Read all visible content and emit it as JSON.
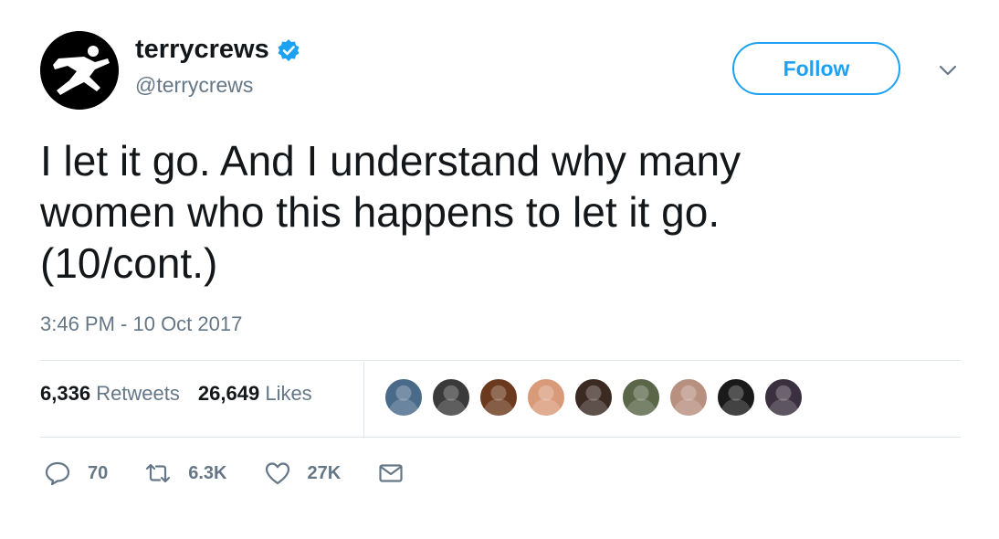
{
  "user": {
    "display_name": "terrycrews",
    "handle": "@terrycrews"
  },
  "follow_label": "Follow",
  "tweet": {
    "lines": [
      "I let it go. And I understand why many",
      "women who this happens to let it go.",
      "(10/cont.)"
    ],
    "timestamp": "3:46 PM - 10 Oct 2017"
  },
  "stats": {
    "retweets_count": "6,336",
    "retweets_label": "Retweets",
    "likes_count": "26,649",
    "likes_label": "Likes"
  },
  "liker_avatar_colors": [
    "#4a6a8a",
    "#3a3a3a",
    "#6b3a1e",
    "#d99a7a",
    "#3b2a22",
    "#5a6648",
    "#b89080",
    "#1a1a1a",
    "#3a3040"
  ],
  "actions": {
    "reply_count": "70",
    "retweet_count": "6.3K",
    "like_count": "27K"
  },
  "colors": {
    "accent": "#1da1f2",
    "text": "#14171a",
    "secondary": "#657786",
    "divider": "#e1e8ed"
  },
  "icons": [
    "verified-badge-icon",
    "caret-down-icon",
    "reply-icon",
    "retweet-icon",
    "like-icon",
    "direct-message-icon"
  ]
}
